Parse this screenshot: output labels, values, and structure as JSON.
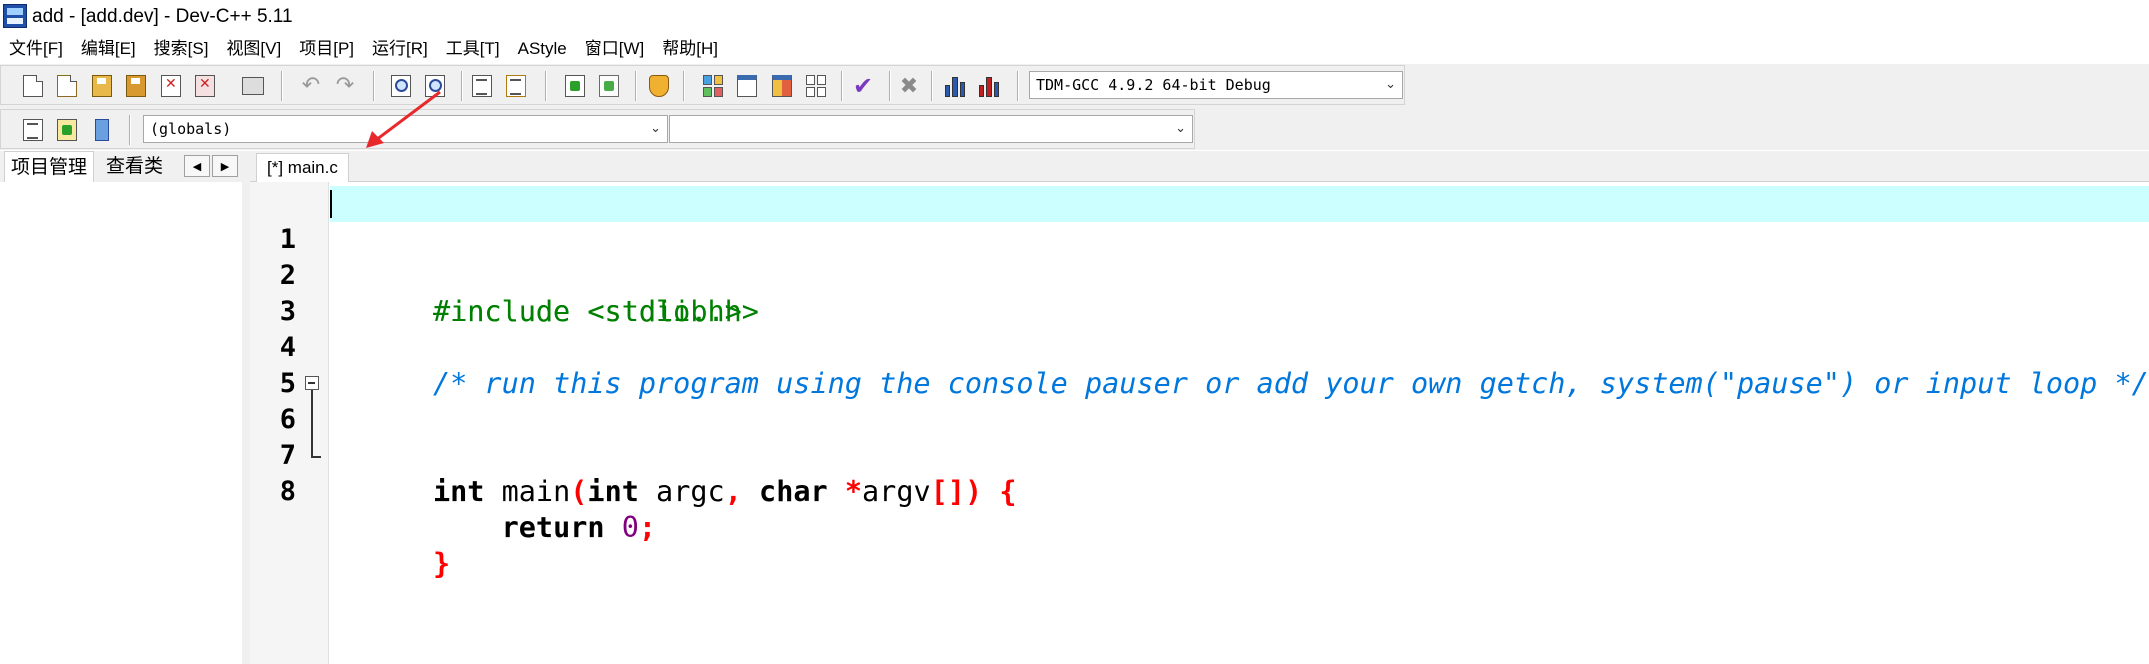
{
  "window": {
    "title": "add - [add.dev] - Dev-C++ 5.11"
  },
  "menu": [
    "文件[F]",
    "编辑[E]",
    "搜索[S]",
    "视图[V]",
    "项目[P]",
    "运行[R]",
    "工具[T]",
    "AStyle",
    "窗口[W]",
    "帮助[H]"
  ],
  "toolbar": {
    "compiler_select": "TDM-GCC 4.9.2 64-bit Debug",
    "globals_select": "(globals)",
    "members_select": ""
  },
  "left_panel": {
    "tabs": [
      "项目管理",
      "查看类"
    ],
    "arrow_left": "◀",
    "arrow_right": "▶"
  },
  "editor": {
    "tab_label": "[*] main.c",
    "line_numbers": [
      "1",
      "2",
      "3",
      "4",
      "5",
      "6",
      "7",
      "8"
    ],
    "lines": {
      "l1": "#include <stdio.h>",
      "l2": "#include <stdlib.h>",
      "l4": "/* run this program using the console pauser or add your own getch, system(\"pause\") or input loop */",
      "l6_kw1": "int",
      "l6_t1": " main",
      "l6_s1": "(",
      "l6_kw2": "int",
      "l6_t2": " argc",
      "l6_s2": ",",
      "l6_t3": " ",
      "l6_kw3": "char",
      "l6_t4": " ",
      "l6_s3": "*",
      "l6_t5": "argv",
      "l6_s4": "[])",
      "l6_t6": " ",
      "l6_s5": "{",
      "l7_indent": "    ",
      "l7_kw": "return",
      "l7_t": " ",
      "l7_num": "0",
      "l7_s": ";",
      "l8_s": "}"
    }
  },
  "colors": {
    "current_line": "#ccffff",
    "preprocessor": "#008000",
    "comment": "#0077dd",
    "symbol": "#ff0000",
    "number": "#800080",
    "annotation_arrow": "#e8282a"
  }
}
